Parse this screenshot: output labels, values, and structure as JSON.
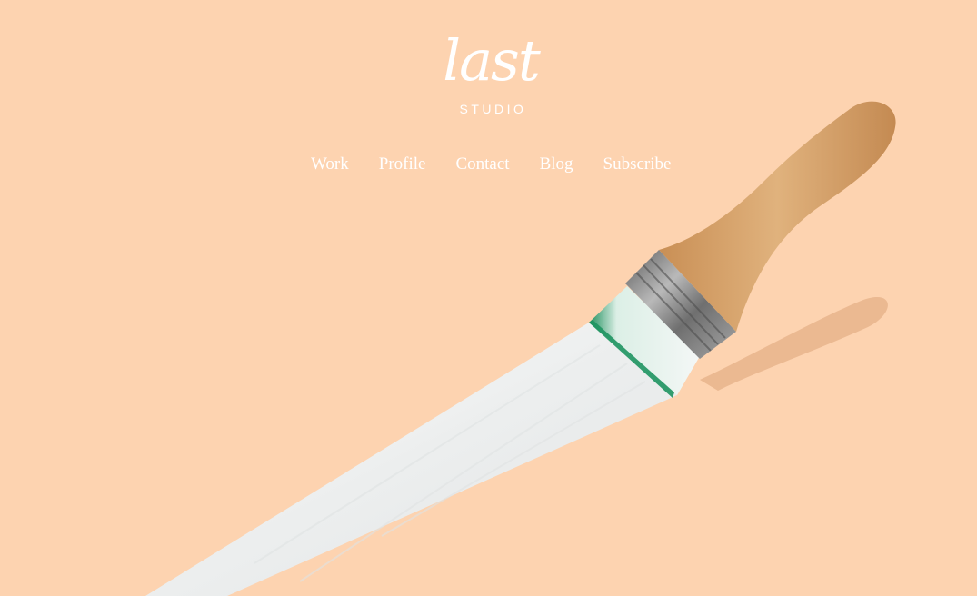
{
  "colors": {
    "background": "#fdd3b0",
    "text": "#ffffff",
    "paint": "#eef0ef",
    "handle": "#d7a56e",
    "ferrule": "#8c8c8c",
    "bristle_tint": "#1e9460"
  },
  "logo": {
    "word": "last",
    "subtitle": "STUDIO"
  },
  "nav": {
    "items": [
      {
        "label": "Work"
      },
      {
        "label": "Profile"
      },
      {
        "label": "Contact"
      },
      {
        "label": "Blog"
      },
      {
        "label": "Subscribe"
      }
    ]
  },
  "hero": {
    "image_icon": "paintbrush-stroke-illustration"
  }
}
